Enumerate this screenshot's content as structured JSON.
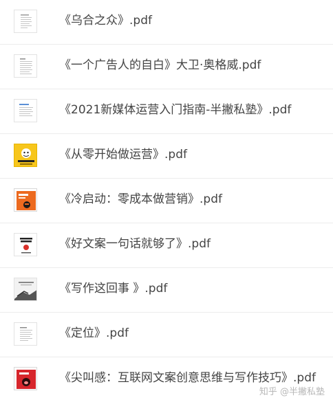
{
  "files": [
    {
      "name": "《乌合之众》.pdf",
      "thumbnail": "document-text-thumbnail"
    },
    {
      "name": "《一个广告人的自白》大卫·奥格威.pdf",
      "thumbnail": "document-text-thumbnail"
    },
    {
      "name": "《2021新媒体运营入门指南-半撇私塾》.pdf",
      "thumbnail": "document-blue-heading-thumbnail"
    },
    {
      "name": "《从零开始做运营》.pdf",
      "thumbnail": "yellow-book-cover-thumbnail"
    },
    {
      "name": "《冷启动：零成本做营销》.pdf",
      "thumbnail": "orange-book-cover-thumbnail"
    },
    {
      "name": "《好文案一句话就够了》.pdf",
      "thumbnail": "white-book-cover-thumbnail"
    },
    {
      "name": "《写作这回事 》.pdf",
      "thumbnail": "gray-book-cover-thumbnail"
    },
    {
      "name": "《定位》.pdf",
      "thumbnail": "document-text-thumbnail"
    },
    {
      "name": "《尖叫感：互联网文案创意思维与写作技巧》.pdf",
      "thumbnail": "red-book-cover-thumbnail"
    }
  ],
  "watermark": "知乎 @半撇私塾",
  "colors": {
    "text": "#444444",
    "divider": "#ececec",
    "watermark": "#b8b8b8"
  }
}
